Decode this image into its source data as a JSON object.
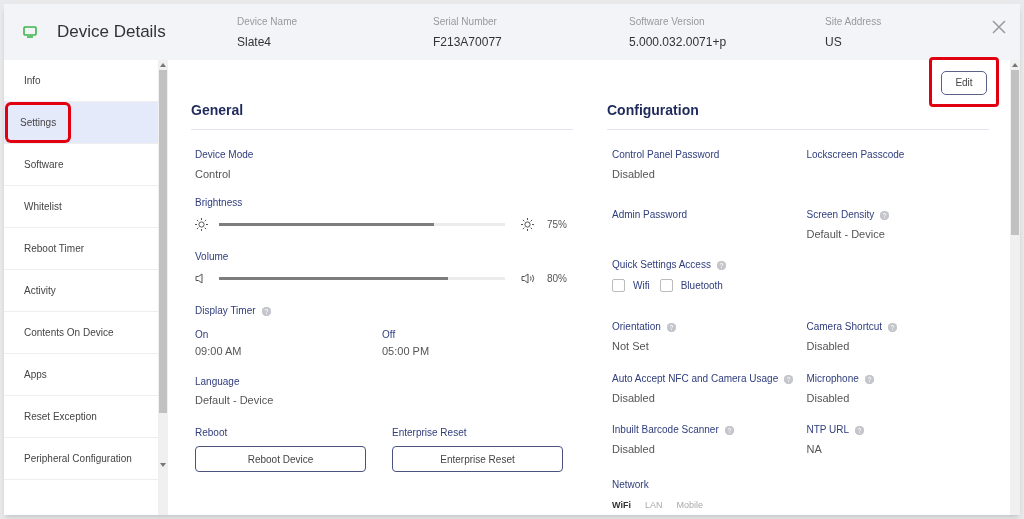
{
  "header": {
    "title": "Device Details",
    "fields": [
      {
        "label": "Device Name",
        "value": "Slate4"
      },
      {
        "label": "Serial Number",
        "value": "F213A70077"
      },
      {
        "label": "Software Version",
        "value": "5.000.032.0071+p"
      },
      {
        "label": "Site Address",
        "value": "US"
      }
    ]
  },
  "sidebar": {
    "items": [
      {
        "label": "Info",
        "selected": false,
        "highlighted": false
      },
      {
        "label": "Settings",
        "selected": true,
        "highlighted": true
      },
      {
        "label": "Software",
        "selected": false,
        "highlighted": false
      },
      {
        "label": "Whitelist",
        "selected": false,
        "highlighted": false
      },
      {
        "label": "Reboot Timer",
        "selected": false,
        "highlighted": false
      },
      {
        "label": "Activity",
        "selected": false,
        "highlighted": false
      },
      {
        "label": "Contents On Device",
        "selected": false,
        "highlighted": false
      },
      {
        "label": "Apps",
        "selected": false,
        "highlighted": false
      },
      {
        "label": "Reset Exception",
        "selected": false,
        "highlighted": false
      },
      {
        "label": "Peripheral Configuration",
        "selected": false,
        "highlighted": false
      }
    ]
  },
  "edit_button": {
    "label": "Edit",
    "highlighted": true
  },
  "general": {
    "title": "General",
    "device_mode": {
      "label": "Device Mode",
      "value": "Control"
    },
    "sliders": [
      {
        "kind": "brightness",
        "label": "Brightness",
        "level": 0.75,
        "reading": "75%"
      },
      {
        "kind": "volume",
        "label": "Volume",
        "level": 0.8,
        "reading": "80%"
      }
    ],
    "display_timer": {
      "label": "Display Timer",
      "help": true,
      "times": [
        {
          "label": "On",
          "value": "09:00 AM"
        },
        {
          "label": "Off",
          "value": "05:00 PM"
        }
      ]
    },
    "language": {
      "label": "Language",
      "value": "Default - Device"
    },
    "actions": [
      {
        "label": "Reboot",
        "button": "Reboot Device"
      },
      {
        "label": "Enterprise Reset",
        "button": "Enterprise Reset"
      }
    ]
  },
  "configuration": {
    "title": "Configuration",
    "items": [
      {
        "kind": "field",
        "label": "Control Panel Password",
        "help": false,
        "value": "Disabled"
      },
      {
        "kind": "field",
        "label": "Lockscreen Passcode",
        "help": false
      },
      {
        "kind": "field",
        "label": "Admin Password",
        "help": false
      },
      {
        "kind": "field",
        "label": "Screen Density",
        "help": true,
        "value": "Default - Device"
      },
      {
        "kind": "checkboxes",
        "label": "Quick Settings Access",
        "help": true,
        "options": [
          {
            "label": "Wifi",
            "checked": false
          },
          {
            "label": "Bluetooth",
            "checked": false
          }
        ]
      },
      {
        "kind": "field",
        "label": "Orientation",
        "help": true,
        "value": "Not Set"
      },
      {
        "kind": "field",
        "label": "Camera Shortcut",
        "help": true,
        "value": "Disabled"
      },
      {
        "kind": "field",
        "label": "Auto Accept NFC and Camera Usage",
        "help": true,
        "value": "Disabled"
      },
      {
        "kind": "field",
        "label": "Microphone",
        "help": true,
        "value": "Disabled"
      },
      {
        "kind": "field",
        "label": "Inbuilt Barcode Scanner",
        "help": true,
        "value": "Disabled"
      },
      {
        "kind": "field",
        "label": "NTP URL",
        "help": true,
        "value": "NA"
      },
      {
        "kind": "tabs",
        "label": "Network",
        "help": false,
        "options": [
          {
            "label": "WiFi",
            "selected": true
          },
          {
            "label": "LAN",
            "selected": false
          },
          {
            "label": "Mobile",
            "selected": false
          }
        ]
      }
    ]
  }
}
